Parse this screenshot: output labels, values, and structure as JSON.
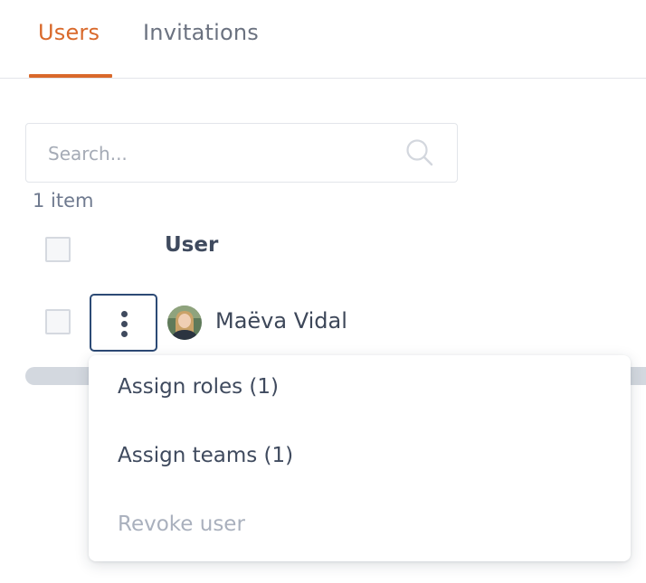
{
  "tabs": [
    {
      "label": "Users",
      "active": true
    },
    {
      "label": "Invitations",
      "active": false
    }
  ],
  "search": {
    "placeholder": "Search...",
    "value": ""
  },
  "results": {
    "count_text": "1 item"
  },
  "table": {
    "columns": [
      "User"
    ],
    "rows": [
      {
        "name": "Maëva Vidal",
        "selected": false
      }
    ]
  },
  "menu": {
    "items": [
      {
        "label": "Assign roles (1)",
        "enabled": true
      },
      {
        "label": "Assign teams (1)",
        "enabled": true
      },
      {
        "label": "Revoke user",
        "enabled": false
      }
    ]
  },
  "icons": {
    "search": "search-icon",
    "kebab": "more-vertical-icon"
  },
  "colors": {
    "accent": "#d9692b",
    "text": "#3f4a5e",
    "muted": "#a9b0bd",
    "focus_border": "#2c4a75"
  }
}
